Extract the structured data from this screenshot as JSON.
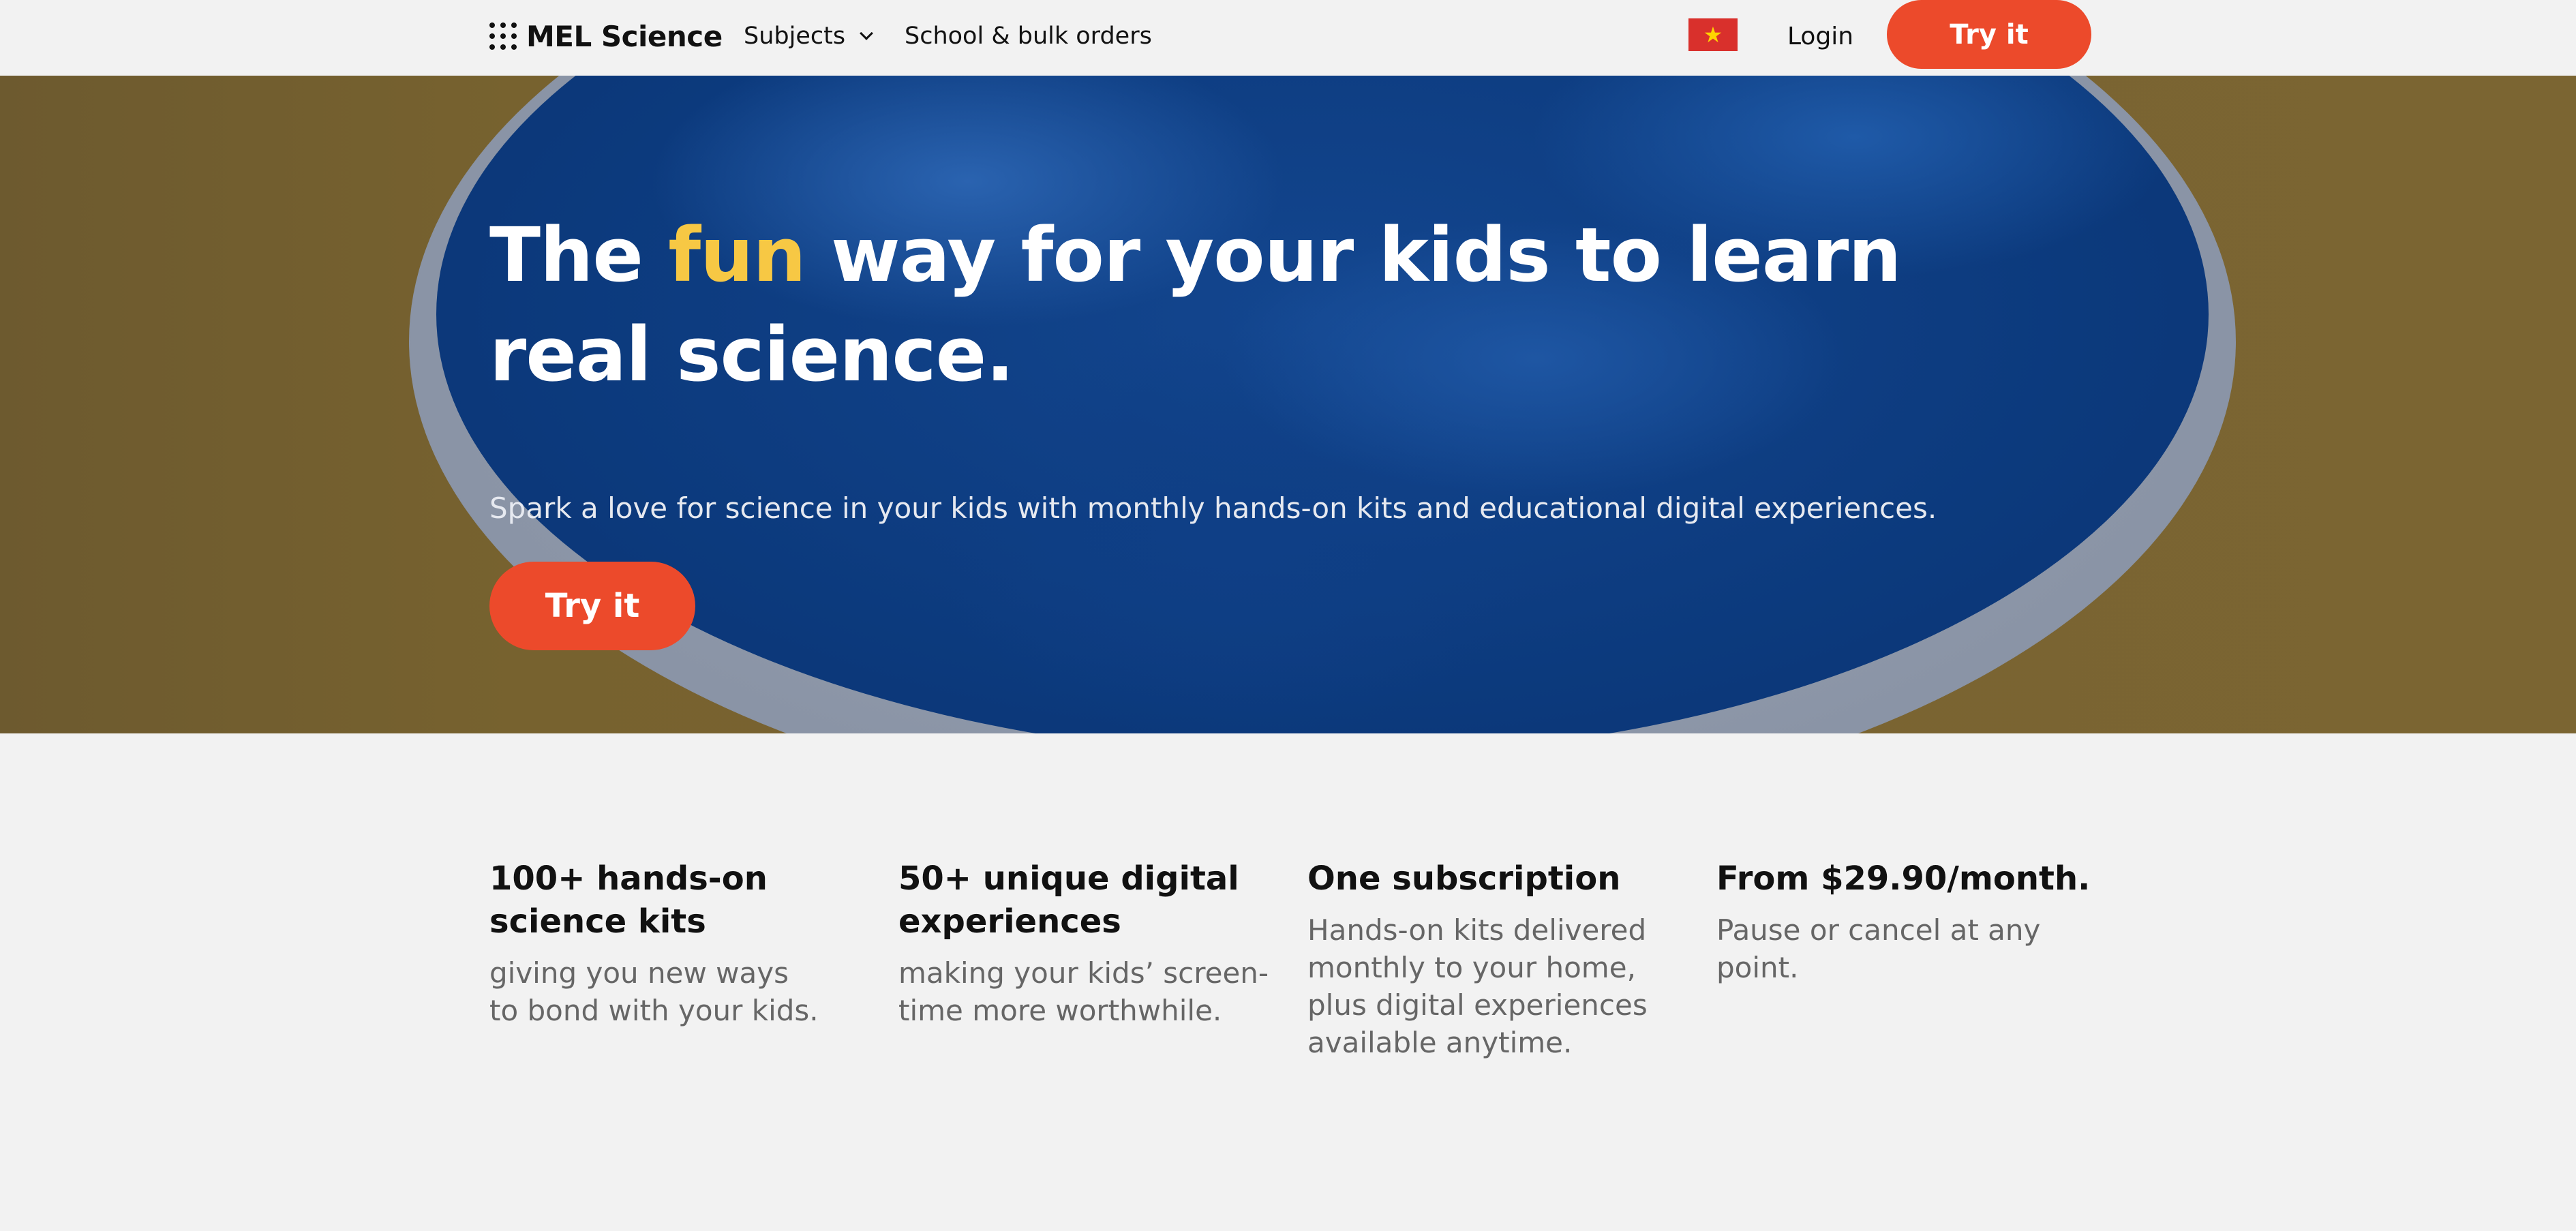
{
  "header": {
    "brand": "MEL Science",
    "nav": {
      "subjects": "Subjects",
      "school": "School & bulk orders"
    },
    "flag_icon": "vietnam-flag-icon",
    "login": "Login",
    "cta": "Try it"
  },
  "hero": {
    "title_before": "The ",
    "title_highlight": "fun",
    "title_after": " way for your kids to learn real science.",
    "subtitle": "Spark a love for science in your kids with monthly hands-on kits and educational digital experiences.",
    "cta": "Try it"
  },
  "features": [
    {
      "title": "100+ hands-on science kits",
      "desc": "giving you new ways\nto bond with your kids."
    },
    {
      "title": "50+ unique digital experiences",
      "desc": "making your kids’ screen-\ntime more worthwhile."
    },
    {
      "title": "One subscription",
      "desc": "Hands-on kits delivered monthly to your home, plus digital experiences available anytime."
    },
    {
      "title": "From $29.90/month.",
      "desc": "Pause or cancel at any point."
    }
  ],
  "colors": {
    "accent": "#ec4a2b",
    "highlight": "#f7c844",
    "background": "#f2f2f2"
  }
}
